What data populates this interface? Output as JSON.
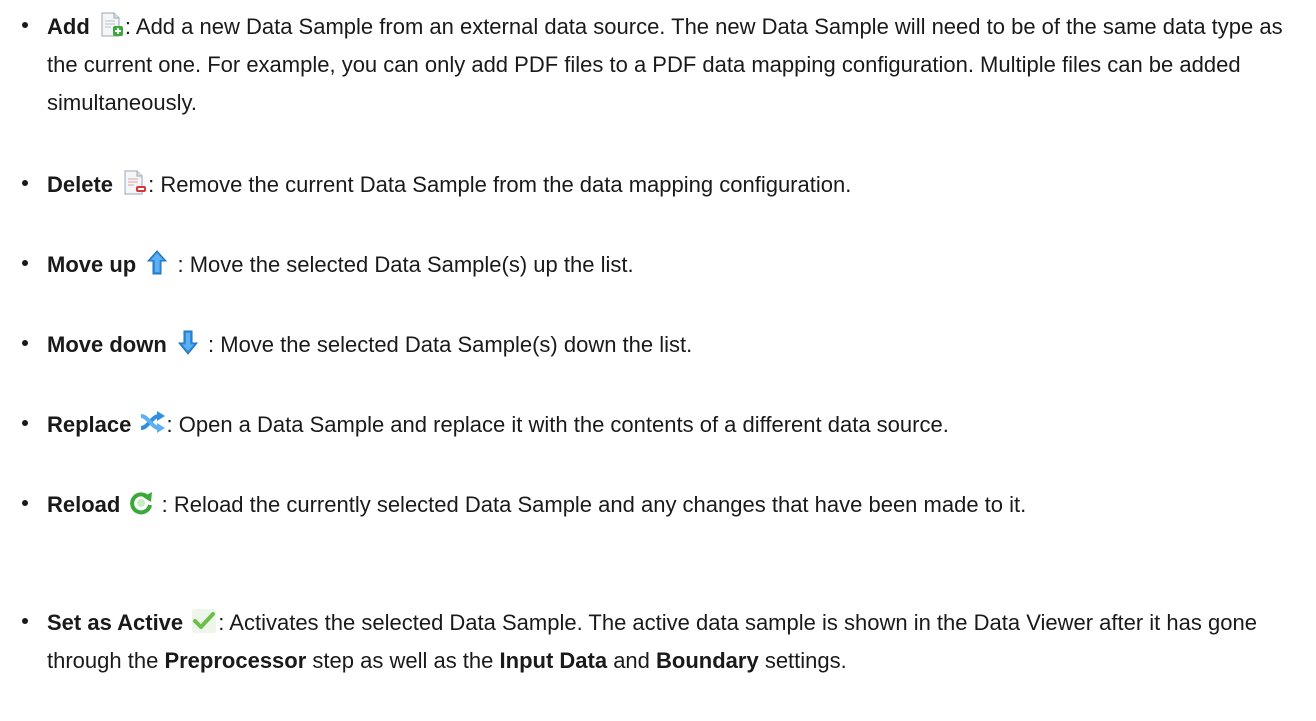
{
  "items": [
    {
      "term": "Add",
      "icon": "add-document-icon",
      "desc": ": Add a new Data Sample from an external data source. The new Data Sample will need to be of the same data type as the current one. For example, you can only add PDF files to a PDF data mapping configuration. Multiple files can be added simultaneously."
    },
    {
      "term": "Delete",
      "icon": "delete-document-icon",
      "desc": ": Remove the current Data Sample from the data mapping configuration."
    },
    {
      "term": "Move up",
      "icon": "arrow-up-icon",
      "desc": " : Move the selected Data Sample(s) up the list."
    },
    {
      "term": "Move down",
      "icon": "arrow-down-icon",
      "desc": " : Move the selected Data Sample(s) down the list."
    },
    {
      "term": "Replace",
      "icon": "replace-shuffle-icon",
      "desc": ": Open a Data Sample and replace it with the contents of a different data source."
    },
    {
      "term": "Reload",
      "icon": "reload-icon",
      "desc": " : Reload the currently selected Data Sample and any changes that have been made to it."
    },
    {
      "term": "Set as Active",
      "icon": "checkmark-icon",
      "desc_part1": ": Activates the selected Data Sample. The active data sample is shown in the Data Viewer after it has gone through the ",
      "bold1": "Preprocessor",
      "desc_part2": " step as well as the ",
      "bold2": "Input Data",
      "desc_part3": " and ",
      "bold3": "Boundary",
      "desc_part4": " settings."
    }
  ],
  "colors": {
    "text": "#1a1a1a",
    "icon_blue": "#2f8fe0",
    "icon_green": "#3aa83a",
    "icon_red": "#d9363e"
  }
}
